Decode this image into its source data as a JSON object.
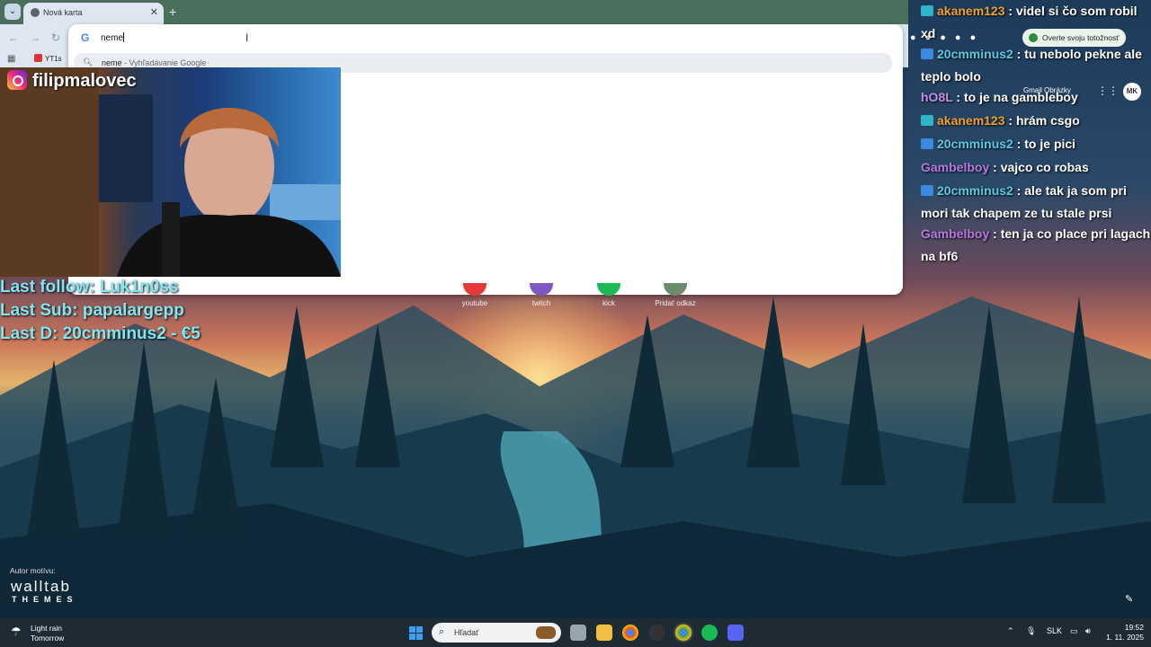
{
  "browser": {
    "tab_title": "Nová karta",
    "tab_close": "✕",
    "new_tab": "+",
    "tab_menu_icon": "chevron-down-icon",
    "bookmark": "YT1s",
    "omnibox_value": "neme",
    "suggestion_query": "neme",
    "suggestion_sub": " - Vyhľadávanie Google",
    "verify_identity": "Overte svoju totožnosť",
    "google_links": "Gmail  Obrázky",
    "profile_initials": "MK"
  },
  "overlay": {
    "instagram_handle": "filipmalovec",
    "last_follow": "Last follow: Luk1n0ss",
    "last_sub": "Last Sub: papalargepp",
    "last_donation": "Last D: 20cmminus2 - €5"
  },
  "shortcuts": [
    {
      "label": "youtube",
      "color": "#e53935"
    },
    {
      "label": "twitch",
      "color": "#7e57c2"
    },
    {
      "label": "kick",
      "color": "#1db954"
    },
    {
      "label": "Pridať odkaz",
      "color": "#6d8a6d"
    }
  ],
  "chat": [
    {
      "user": "akanem123",
      "user_color": "#f0a030",
      "message": " : videl si čo som robil xd",
      "badge": "#2fb5c9"
    },
    {
      "user": "20cmminus2",
      "user_color": "#5bc8e6",
      "message": " : tu nebolo pekne ale teplo bolo",
      "badge": "#3a8be0"
    },
    {
      "user": "hO8L",
      "user_color": "#c78de6",
      "message": " : to je na gambleboy",
      "badge": ""
    },
    {
      "user": "akanem123",
      "user_color": "#f0a030",
      "message": " : hrám csgo",
      "badge": "#2fb5c9"
    },
    {
      "user": "20cmminus2",
      "user_color": "#5bc8e6",
      "message": " : to je pici",
      "badge": "#3a8be0"
    },
    {
      "user": "Gambelboy",
      "user_color": "#b77be0",
      "message": " : vajco co robas",
      "badge": ""
    },
    {
      "user": "20cmminus2",
      "user_color": "#5bc8e6",
      "message": " : ale tak ja som pri mori tak chapem ze tu stale prsi",
      "badge": "#3a8be0"
    },
    {
      "user": "Gambelboy",
      "user_color": "#b77be0",
      "message": " : ten ja co place pri lagach na bf6",
      "badge": ""
    }
  ],
  "newtab": {
    "theme_author_label": "Autor motívu:",
    "theme_brand": "walltab",
    "theme_brand_sub": "THEMES"
  },
  "taskbar": {
    "weather_title": "Light rain",
    "weather_sub": "Tomorrow",
    "search_placeholder": "Hľadať",
    "language": "SLK",
    "time": "19:52",
    "date": "1. 11. 2025"
  }
}
